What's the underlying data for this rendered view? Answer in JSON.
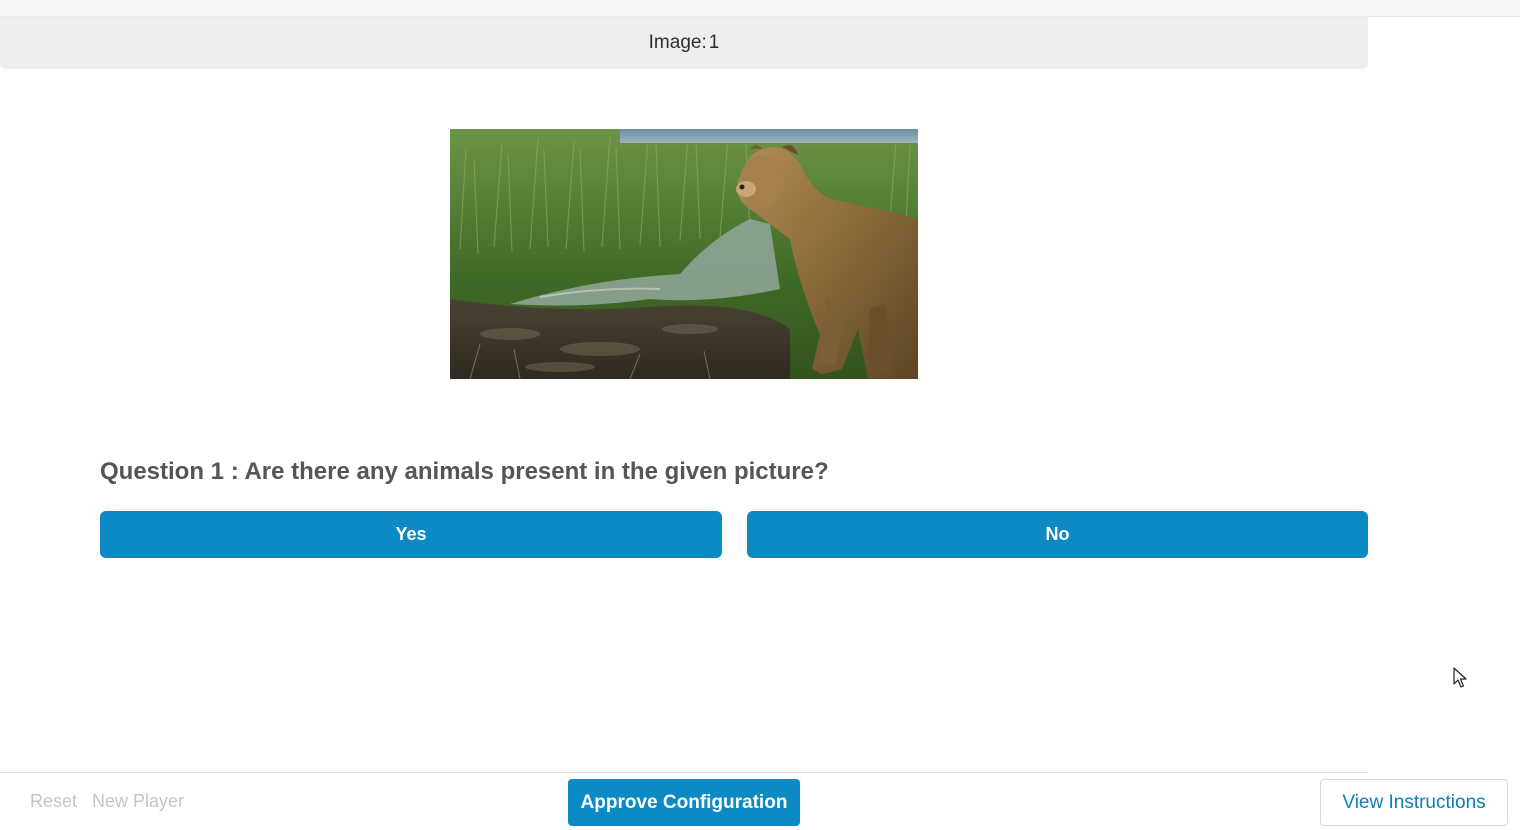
{
  "header": {
    "image_label": "Image:",
    "image_number": "1"
  },
  "photo": {
    "subject": "lioness-at-waterhole",
    "colors": {
      "grass": "#4f7a2c",
      "mud": "#3d3528",
      "water": "#9fb0a4",
      "lion": "#8a6a3a"
    }
  },
  "question": {
    "text": "Question 1 : Are there any animals present in the given picture?",
    "options": [
      "Yes",
      "No"
    ]
  },
  "footer": {
    "reset_label": "Reset",
    "new_player_label": "New Player",
    "approve_label": "Approve Configuration",
    "instructions_label": "View Instructions"
  },
  "theme": {
    "accent": "#0d89c4",
    "header_bg": "#eeeeee",
    "muted_text": "#c2c4c7"
  }
}
